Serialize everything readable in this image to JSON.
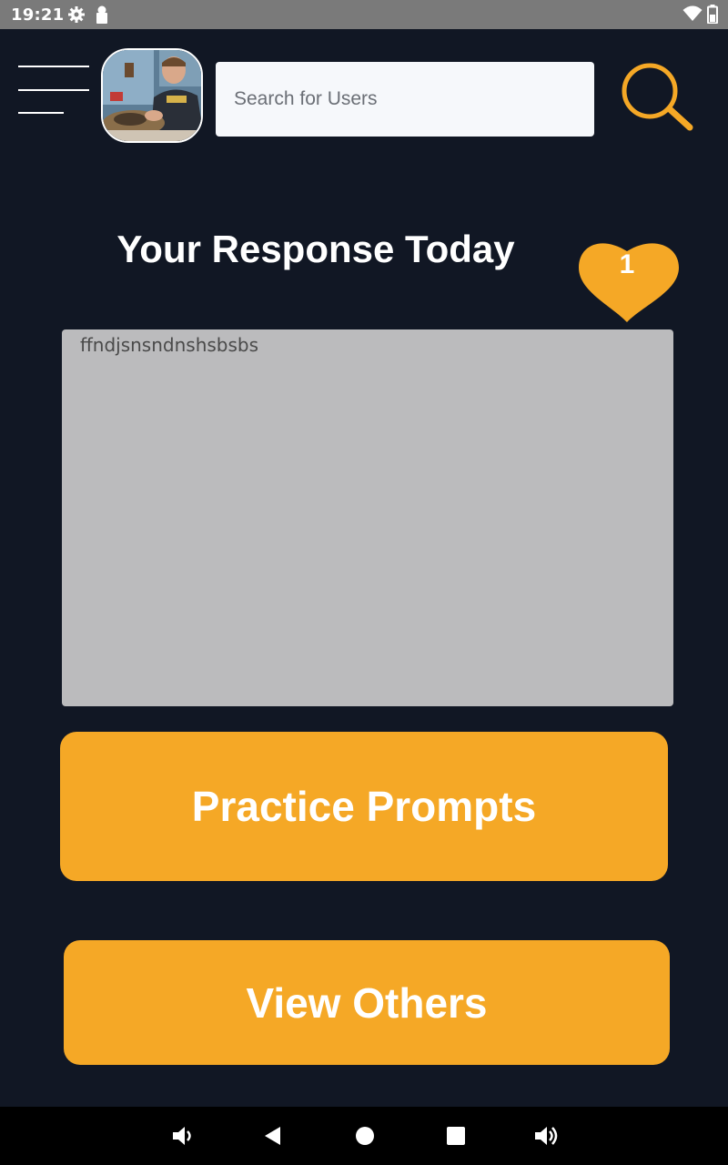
{
  "status_bar": {
    "time": "19:21",
    "icons": [
      "gear-icon",
      "lock-icon",
      "wifi-icon",
      "battery-icon"
    ]
  },
  "header": {
    "menu_icon": "hamburger-icon",
    "avatar_alt": "profile photo",
    "search": {
      "placeholder": "Search for Users",
      "value": ""
    },
    "search_icon": "search-icon"
  },
  "main": {
    "title": "Your Response Today",
    "likes": {
      "count": "1",
      "icon": "heart-icon",
      "color": "#f5a826"
    },
    "response_text": "ffndjsnsndnshsbsbs",
    "buttons": {
      "practice": "Practice Prompts",
      "view_others": "View Others"
    }
  },
  "nav_bar": {
    "icons": [
      "volume-down-icon",
      "back-icon",
      "home-icon",
      "recents-icon",
      "volume-up-icon"
    ]
  },
  "colors": {
    "background": "#111724",
    "accent": "#f5a826",
    "response_box": "#bbbbbd"
  }
}
